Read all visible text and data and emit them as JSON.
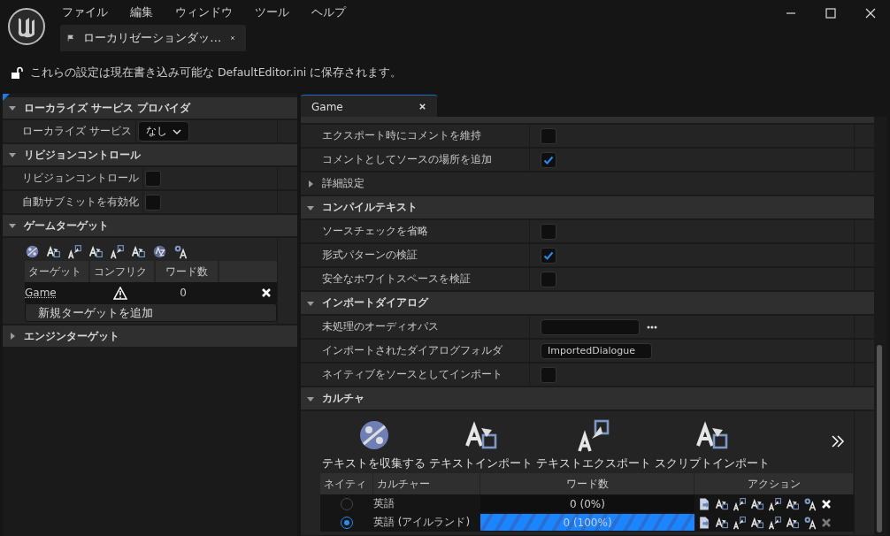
{
  "menu": [
    {
      "label": "ファイル"
    },
    {
      "label": "編集"
    },
    {
      "label": "ウィンドウ"
    },
    {
      "label": "ツール"
    },
    {
      "label": "ヘルプ"
    }
  ],
  "document_tab": {
    "label": "ローカリゼーションダッ…"
  },
  "notice": {
    "locked": false,
    "text": "これらの設定は現在書き込み可能な DefaultEditor.ini に保存されます。"
  },
  "settings_panel": {
    "sections": [
      {
        "title": "ローカライズ サービス プロバイダ",
        "expanded": true,
        "rows": [
          {
            "kind": "dropdown",
            "label": "ローカライズ サービス",
            "value": "なし"
          }
        ]
      },
      {
        "title": "リビジョンコントロール",
        "expanded": true,
        "rows": [
          {
            "kind": "checkbox",
            "label": "リビジョンコントロール",
            "checked": false
          },
          {
            "kind": "checkbox",
            "label": "自動サブミットを有効化",
            "checked": false
          }
        ]
      },
      {
        "title": "ゲームターゲット",
        "expanded": true,
        "rows": [
          {
            "kind": "targets",
            "columns": [
              "ターゲット",
              "コンフリク",
              "ワード数"
            ],
            "targets": [
              {
                "name": "Game",
                "has_conflicts": true,
                "word_count": "0"
              }
            ],
            "add_button": "新規ターゲットを追加"
          }
        ]
      },
      {
        "title": "エンジンターゲット",
        "expanded": false
      }
    ]
  },
  "editor_tab": {
    "label": "Game"
  },
  "target_settings": {
    "sections": [
      {
        "rows": [
          {
            "kind": "checkbox",
            "label": "エクスポート時にコメントを維持",
            "checked": false
          },
          {
            "kind": "checkbox",
            "label": "コメントとしてソースの場所を追加",
            "checked": true
          },
          {
            "kind": "group",
            "label": "詳細設定",
            "expanded": false
          }
        ]
      },
      {
        "title": "コンパイルテキスト",
        "expanded": true,
        "rows": [
          {
            "kind": "checkbox",
            "label": "ソースチェックを省略",
            "checked": false
          },
          {
            "kind": "checkbox",
            "label": "形式パターンの検証",
            "checked": true
          },
          {
            "kind": "checkbox",
            "label": "安全なホワイトスペースを検証",
            "checked": false
          }
        ]
      },
      {
        "title": "インポートダイアログ",
        "expanded": true,
        "rows": [
          {
            "kind": "path",
            "label": "未処理のオーディオパス"
          },
          {
            "kind": "text",
            "label": "インポートされたダイアログフォルダ",
            "value": "ImportedDialogue"
          },
          {
            "kind": "checkbox",
            "label": "ネイティブをソースとしてインポート",
            "checked": false
          }
        ]
      },
      {
        "title": "カルチャ",
        "expanded": true,
        "rows": [
          {
            "kind": "cultures",
            "actions": [
              "テキストを収集する",
              "テキストインポート",
              "テキストエクスポート",
              "スクリプトインポート"
            ],
            "columns": [
              "ネイティ",
              "カルチャー",
              "ワード数",
              "アクション"
            ],
            "cultures": [
              {
                "selected": false,
                "name": "英語",
                "level": 0,
                "reading": "0 (0%)",
                "removable": true
              },
              {
                "selected": true,
                "name": "英語 (アイルランド)",
                "level": 1,
                "reading": "0 (100%)",
                "removable": false
              }
            ]
          }
        ]
      }
    ]
  }
}
